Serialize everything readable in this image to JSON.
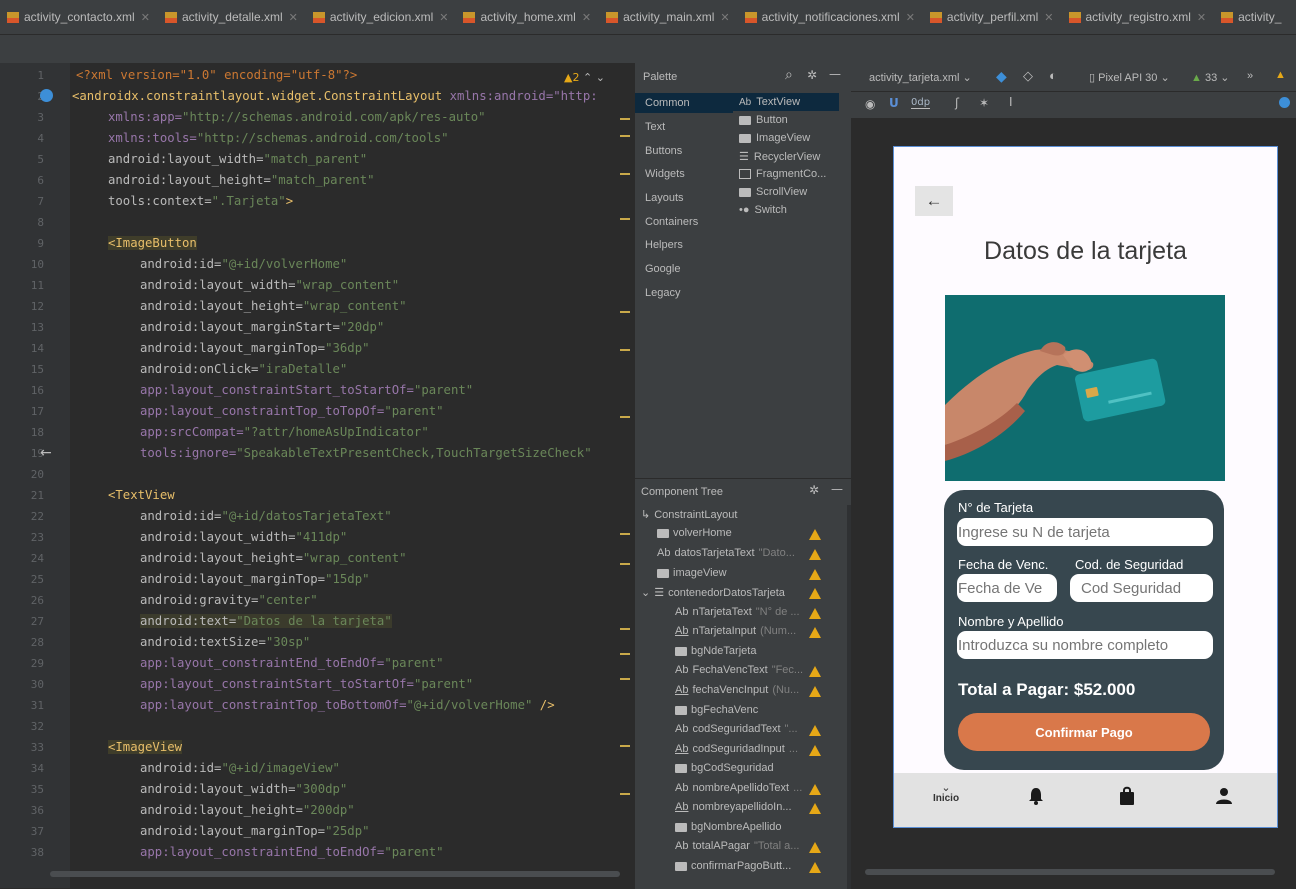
{
  "tabs": [
    "activity_contacto.xml",
    "activity_detalle.xml",
    "activity_edicion.xml",
    "activity_home.xml",
    "activity_main.xml",
    "activity_notificaciones.xml",
    "activity_perfil.xml",
    "activity_registro.xml",
    "activity_"
  ],
  "editor": {
    "warning_count": "2",
    "lines": [
      "1",
      "2",
      "3",
      "4",
      "5",
      "6",
      "7",
      "8",
      "9",
      "10",
      "11",
      "12",
      "13",
      "14",
      "15",
      "16",
      "17",
      "18",
      "19",
      "20",
      "21",
      "22",
      "23",
      "24",
      "25",
      "26",
      "27",
      "28",
      "29",
      "30",
      "31",
      "32",
      "33",
      "34",
      "35",
      "36",
      "37",
      "38"
    ],
    "code": {
      "l1": "<?xml version=\"1.0\" encoding=\"utf-8\"?>",
      "l2a": "<androidx.constraintlayout.widget.ConstraintLayout",
      "l2b": " xmlns:android=\"http:",
      "l3a": "xmlns:app=",
      "l3b": "\"http://schemas.android.com/apk/res-auto\"",
      "l4a": "xmlns:tools=",
      "l4b": "\"http://schemas.android.com/tools\"",
      "l5a": "android:layout_width=",
      "l5b": "\"match_parent\"",
      "l6a": "android:layout_height=",
      "l6b": "\"match_parent\"",
      "l7a": "tools:context=",
      "l7b": "\".Tarjeta\"",
      "l7c": ">",
      "l9": "<ImageButton",
      "l10a": "android:id=",
      "l10b": "\"@+id/volverHome\"",
      "l11a": "android:layout_width=",
      "l11b": "\"wrap_content\"",
      "l12a": "android:layout_height=",
      "l12b": "\"wrap_content\"",
      "l13a": "android:layout_marginStart=",
      "l13b": "\"20dp\"",
      "l14a": "android:layout_marginTop=",
      "l14b": "\"36dp\"",
      "l15a": "android:onClick=",
      "l15b": "\"iraDetalle\"",
      "l16a": "app:layout_constraintStart_toStartOf=",
      "l16b": "\"parent\"",
      "l17a": "app:layout_constraintTop_toTopOf=",
      "l17b": "\"parent\"",
      "l18a": "app:srcCompat=",
      "l18b": "\"?attr/homeAsUpIndicator\"",
      "l19a": "tools:ignore=",
      "l19b": "\"SpeakableTextPresentCheck,TouchTargetSizeCheck\"",
      "l21": "<TextView",
      "l22a": "android:id=",
      "l22b": "\"@+id/datosTarjetaText\"",
      "l23a": "android:layout_width=",
      "l23b": "\"411dp\"",
      "l24a": "android:layout_height=",
      "l24b": "\"wrap_content\"",
      "l25a": "android:layout_marginTop=",
      "l25b": "\"15dp\"",
      "l26a": "android:gravity=",
      "l26b": "\"center\"",
      "l27a": "android:text=",
      "l27b": "\"Datos de la tarjeta\"",
      "l28a": "android:textSize=",
      "l28b": "\"30sp\"",
      "l29a": "app:layout_constraintEnd_toEndOf=",
      "l29b": "\"parent\"",
      "l30a": "app:layout_constraintStart_toStartOf=",
      "l30b": "\"parent\"",
      "l31a": "app:layout_constraintTop_toBottomOf=",
      "l31b": "\"@+id/volverHome\"",
      "l31c": " />",
      "l33": "<ImageView",
      "l34a": "android:id=",
      "l34b": "\"@+id/imageView\"",
      "l35a": "android:layout_width=",
      "l35b": "\"300dp\"",
      "l36a": "android:layout_height=",
      "l36b": "\"200dp\"",
      "l37a": "android:layout_marginTop=",
      "l37b": "\"25dp\"",
      "l38a": "app:layout_constraintEnd_toEndOf=",
      "l38b": "\"parent\""
    }
  },
  "palette": {
    "title": "Palette",
    "categories": [
      "Common",
      "Text",
      "Buttons",
      "Widgets",
      "Layouts",
      "Containers",
      "Helpers",
      "Google",
      "Legacy"
    ],
    "items": [
      "TextView",
      "Button",
      "ImageView",
      "RecyclerView",
      "FragmentCo...",
      "ScrollView",
      "Switch"
    ]
  },
  "tree": {
    "title": "Component Tree",
    "items": [
      {
        "label": "ConstraintLayout",
        "hint": ""
      },
      {
        "label": "volverHome",
        "hint": ""
      },
      {
        "label": "datosTarjetaText",
        "hint": "\"Dato..."
      },
      {
        "label": "imageView",
        "hint": ""
      },
      {
        "label": "contenedorDatosTarjeta",
        "hint": ""
      },
      {
        "label": "nTarjetaText",
        "hint": "\"N° de ..."
      },
      {
        "label": "nTarjetaInput",
        "hint": "(Num..."
      },
      {
        "label": "bgNdeTarjeta",
        "hint": ""
      },
      {
        "label": "FechaVencText",
        "hint": "\"Fec..."
      },
      {
        "label": "fechaVencInput",
        "hint": "(Nu..."
      },
      {
        "label": "bgFechaVenc",
        "hint": ""
      },
      {
        "label": "codSeguridadText",
        "hint": "\"..."
      },
      {
        "label": "codSeguridadInput",
        "hint": "..."
      },
      {
        "label": "bgCodSeguridad",
        "hint": ""
      },
      {
        "label": "nombreApellidoText",
        "hint": "..."
      },
      {
        "label": "nombreyapellidoIn...",
        "hint": ""
      },
      {
        "label": "bgNombreApellido",
        "hint": ""
      },
      {
        "label": "totalAPagar",
        "hint": "\"Total a..."
      },
      {
        "label": "confirmarPagoButt...",
        "hint": ""
      }
    ]
  },
  "designbar": {
    "file": "activity_tarjeta.xml",
    "device": "Pixel API 30",
    "api": "33",
    "dp": "0dp"
  },
  "phone": {
    "title": "Datos de la tarjeta",
    "card_number_label": "N° de Tarjeta",
    "card_number_placeholder": "Ingrese su N de tarjeta",
    "expiry_label": "Fecha de Venc.",
    "expiry_placeholder": "Fecha de Ve",
    "cvv_label": "Cod. de Seguridad",
    "cvv_placeholder": "Cod Seguridad",
    "name_label": "Nombre y Apellido",
    "name_placeholder": "Introduzca su nombre completo",
    "total": "Total a Pagar: $52.000",
    "confirm_button": "Confirmar Pago",
    "nav_home": "Inicio",
    "colors": {
      "image_bg": "#0f6d6f",
      "form_bg": "#37474f",
      "button": "#d9784a",
      "navbar": "#e2e2e2"
    }
  }
}
